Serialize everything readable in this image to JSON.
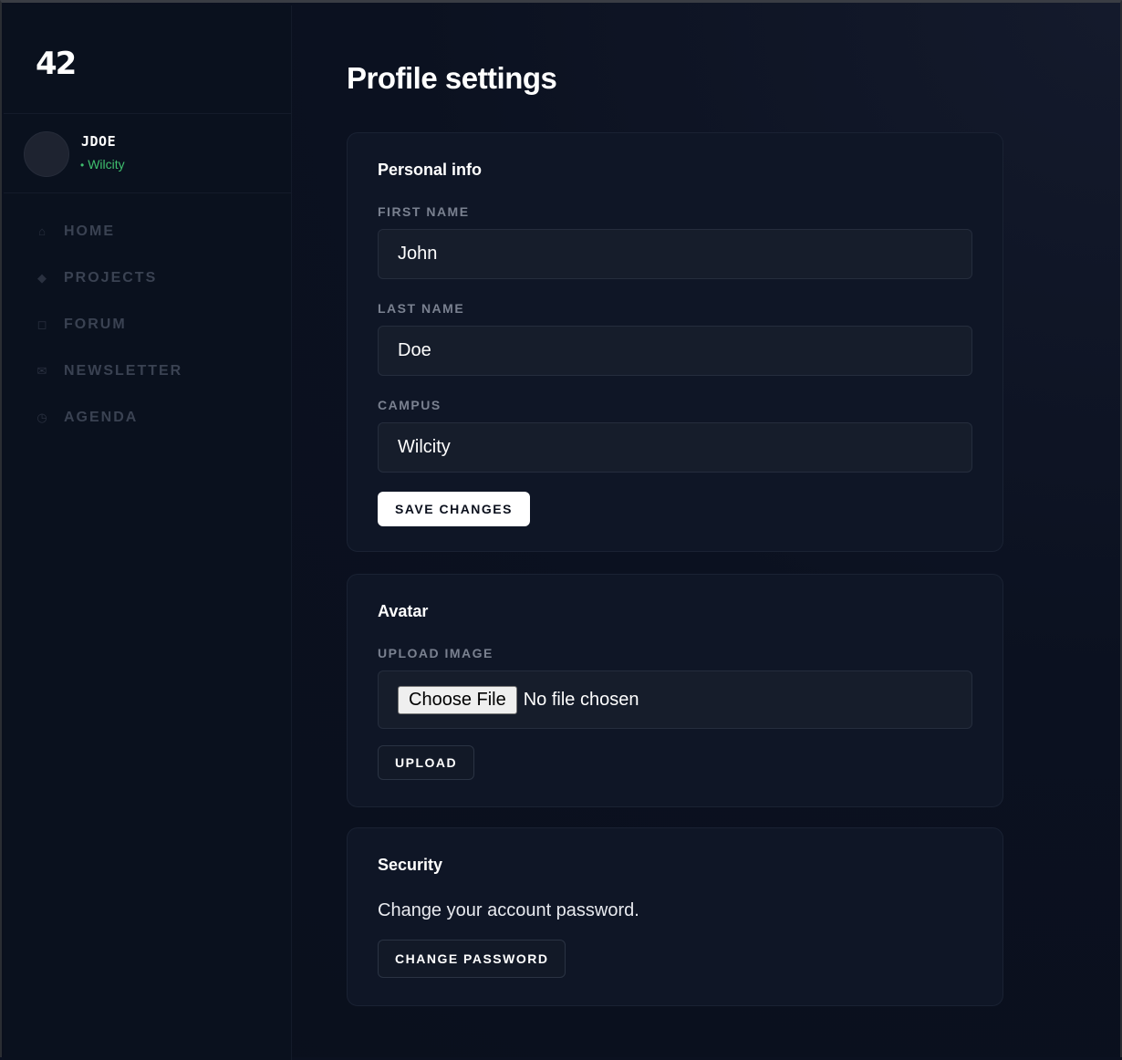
{
  "sidebar": {
    "logo": "42",
    "user": {
      "username": "JDOE",
      "campus_dot": "•",
      "campus": "Wilcity"
    },
    "nav": [
      {
        "icon": "home-icon",
        "glyph": "⌂",
        "label": "HOME"
      },
      {
        "icon": "diamond-icon",
        "glyph": "◆",
        "label": "PROJECTS"
      },
      {
        "icon": "square-icon",
        "glyph": "◻",
        "label": "FORUM"
      },
      {
        "icon": "envelope-icon",
        "glyph": "✉",
        "label": "NEWSLETTER"
      },
      {
        "icon": "clock-icon",
        "glyph": "◷",
        "label": "AGENDA"
      }
    ]
  },
  "main": {
    "title": "Profile settings",
    "personal_info": {
      "title": "Personal info",
      "first_name_label": "FIRST NAME",
      "first_name_value": "John",
      "last_name_label": "LAST NAME",
      "last_name_value": "Doe",
      "campus_label": "CAMPUS",
      "campus_value": "Wilcity",
      "save_label": "SAVE CHANGES"
    },
    "avatar": {
      "title": "Avatar",
      "upload_label": "UPLOAD IMAGE",
      "choose_file_label": "Choose File",
      "file_status": "No file chosen",
      "upload_button": "UPLOAD"
    },
    "security": {
      "title": "Security",
      "description": "Change your account password.",
      "change_password_button": "CHANGE PASSWORD"
    }
  },
  "colors": {
    "background": "#0b1120",
    "sidebar": "#0a111e",
    "card": "#0f1626",
    "accent_green": "#3fbf6e",
    "primary_button": "#ffffff"
  }
}
